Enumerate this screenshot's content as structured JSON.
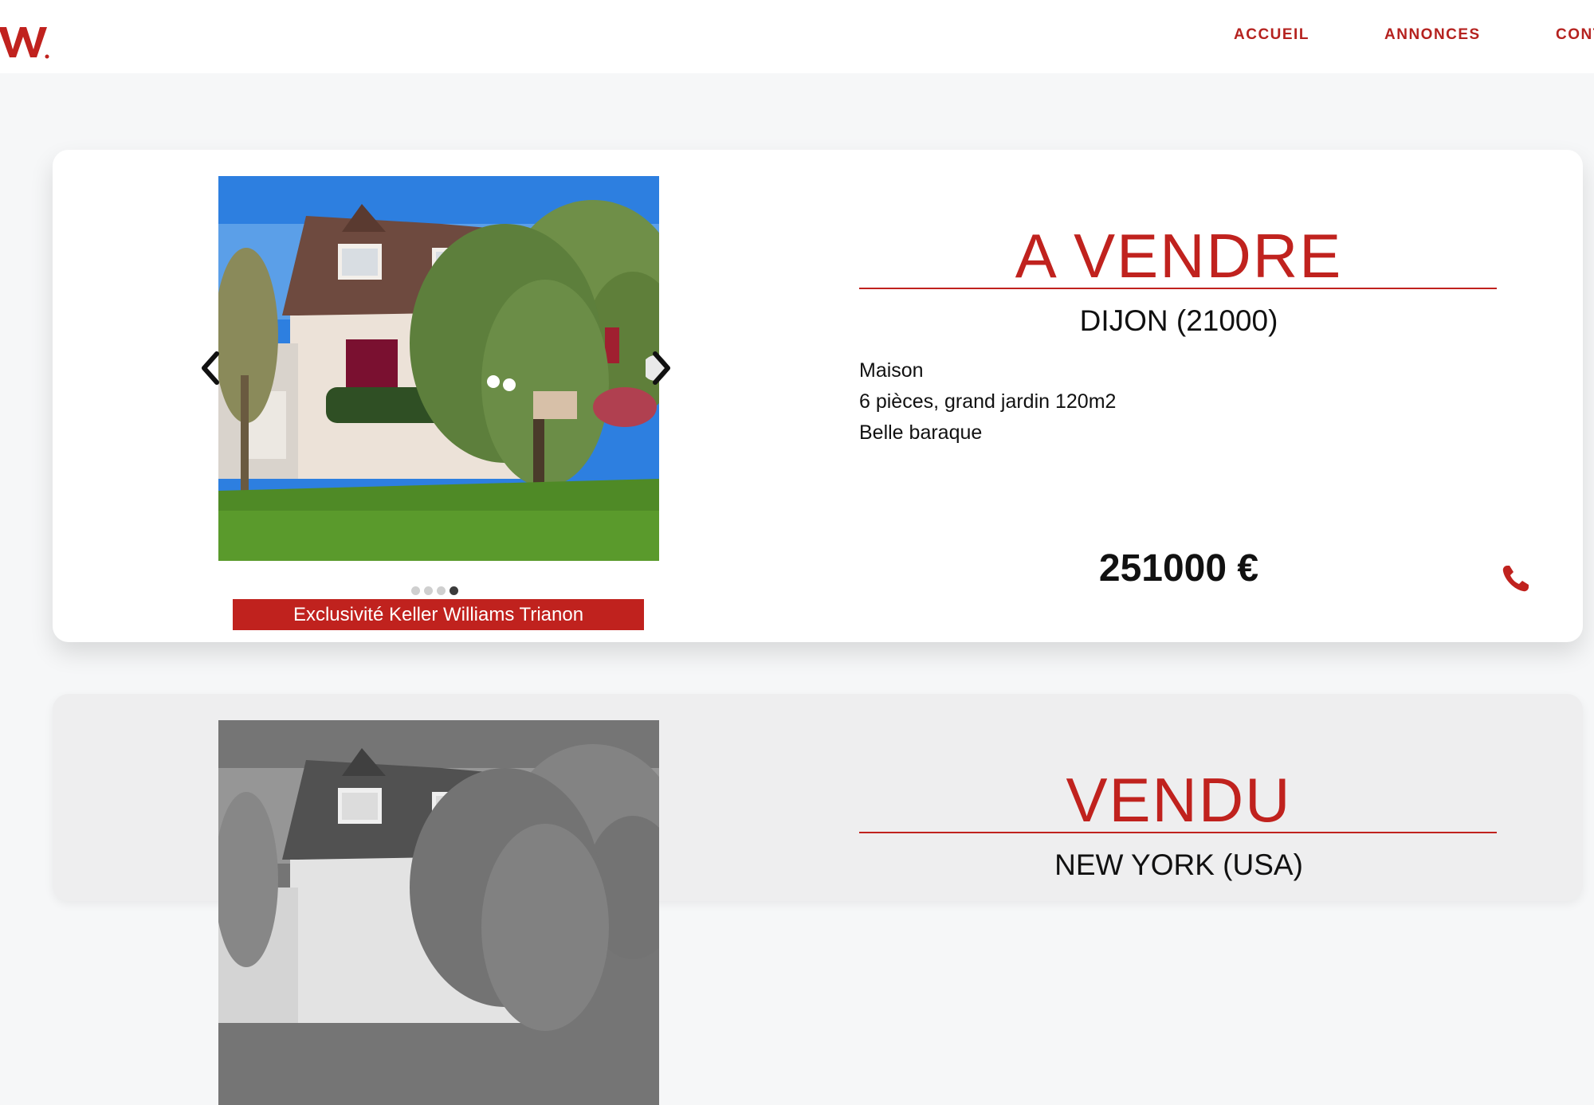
{
  "header": {
    "nav": [
      {
        "label": "ACCUEIL"
      },
      {
        "label": "ANNONCES"
      },
      {
        "label": "CONT"
      }
    ]
  },
  "colors": {
    "brand": "#c0221e",
    "page_background": "#f6f7f8"
  },
  "listings": [
    {
      "status": "A VENDRE",
      "city": "DIJON (21000)",
      "description": [
        "Maison",
        "6 pièces, grand jardin 120m2",
        "Belle baraque"
      ],
      "price": "251000 €",
      "badge": "Exclusivité Keller Williams Trianon",
      "carousel": {
        "slides": 4,
        "active_slide": 4
      },
      "photo_style": "color"
    },
    {
      "status": "VENDU",
      "city": "NEW YORK (USA)",
      "photo_style": "grayscale"
    }
  ],
  "icons": {
    "prev": "chevron-left-icon",
    "next": "chevron-right-icon",
    "phone": "phone-icon"
  }
}
